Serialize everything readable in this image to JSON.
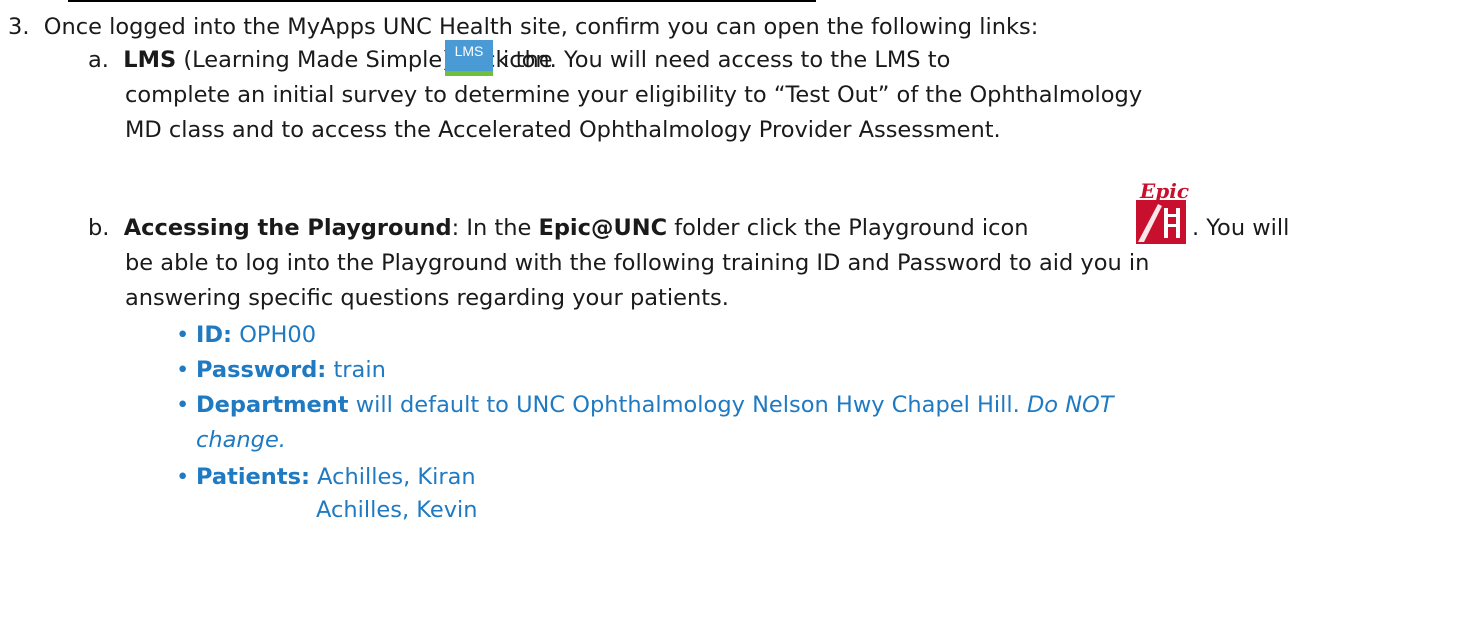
{
  "step3": {
    "number": "3.",
    "text": "Once logged into the MyApps UNC Health site, confirm you can open the following links:"
  },
  "item_a": {
    "letter": "a.",
    "title": "LMS",
    "text1": " (Learning Made Simple) click the",
    "icon_label": "LMS",
    "text2": "icon.  You will need access to the LMS to",
    "line2": "complete an initial survey to determine your eligibility to “Test Out” of the Ophthalmology",
    "line3": "MD class and to access the Accelerated Ophthalmology Provider Assessment."
  },
  "item_b": {
    "letter": "b.",
    "title": "Accessing the Playground",
    "text1": ": In the ",
    "folder": "Epic@UNC",
    "text2": " folder click the Playground icon",
    "text3": ". You will",
    "icon_label": "Epic",
    "line2": "be able to log into the Playground with the following training ID and Password to aid you in",
    "line3": "answering specific questions regarding your patients."
  },
  "bullets": {
    "id_label": "ID:",
    "id_value": " OPH00",
    "password_label": "Password:",
    "password_value": " train",
    "department_label": "Department",
    "department_value": " will default to UNC Ophthalmology Nelson Hwy Chapel Hill. ",
    "department_note1": "Do NOT",
    "department_note2": "change.",
    "patients_label": "Patients:",
    "patient1": " Achilles, Kiran",
    "patient2": "Achilles, Kevin"
  },
  "colors": {
    "accent": "#1f7ac2",
    "lms_icon": "#4a9ad6",
    "epic_icon": "#c8102e"
  }
}
